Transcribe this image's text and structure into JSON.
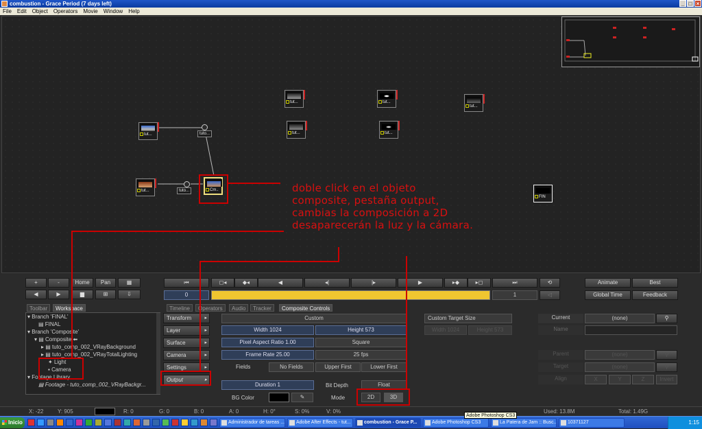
{
  "window": {
    "title": "combustion - Grace Period (7 days left)"
  },
  "menu": [
    "File",
    "Edit",
    "Object",
    "Operators",
    "Movie",
    "Window",
    "Help"
  ],
  "nodes": {
    "short": "tut...",
    "composite": "Cm..",
    "connector": "tuto...",
    "final": "FIN"
  },
  "annotation": [
    "doble click en el objeto",
    "composite, pestaña output,",
    "cambias la composición a 2D",
    "desaparecerán la luz y la cámara."
  ],
  "controls": {
    "plus": "+",
    "minus": "-",
    "home": "Home",
    "pan": "Pan",
    "frame_current": "0",
    "frame_end": "1",
    "animate": "Animate",
    "best": "Best",
    "global_time": "Global Time",
    "feedback": "Feedback"
  },
  "tabs_left": [
    "Toolbar",
    "Workspace"
  ],
  "tabs_right": [
    "Timeline",
    "Operators",
    "Audio",
    "Tracker",
    "Composite Controls"
  ],
  "tree": [
    "Branch 'FINAL'",
    "FINAL",
    "Branch 'Composite'",
    "Composite",
    "tuto_comp_002_VRayBackground",
    "tuto_comp_002_VRayTotalLighting",
    "Light",
    "Camera",
    "Footage Library",
    "Footage - tuto_comp_002_VRayBackgr..."
  ],
  "side_menu": [
    "Transform",
    "Layer",
    "Surface",
    "Camera",
    "Settings",
    "Output"
  ],
  "output": {
    "preset": "Custom",
    "width": "Width 1024",
    "height": "Height 573",
    "aspect": "Pixel Aspect Ratio 1.00",
    "square": "Square",
    "frame_rate": "Frame Rate 25.00",
    "fps": "25 fps",
    "fields_label": "Fields",
    "no_fields": "No Fields",
    "upper_first": "Upper First",
    "lower_first": "Lower First",
    "duration": "Duration 1",
    "bit_depth": "Bit Depth",
    "float": "Float",
    "bg_color": "BG Color",
    "mode": "Mode",
    "mode_2d": "2D",
    "mode_3d": "3D",
    "custom_target": "Custom Target Size",
    "target_w": "Width 1024",
    "target_h": "Height 573"
  },
  "object": {
    "current": "Current",
    "none": "(none)",
    "name": "Name",
    "parent": "Parent",
    "target": "Target",
    "align": "Align",
    "x": "X",
    "y": "Y",
    "z": "Z",
    "invert": "Invert"
  },
  "status": {
    "x": "X:   -22",
    "y": "Y:  905",
    "r": "R: 0",
    "g": "G: 0",
    "b": "B: 0",
    "a": "A: 0",
    "h": "H: 0°",
    "s": "S: 0%",
    "v": "V: 0%",
    "used": "Used: 13.8M",
    "total": "Total: 1.49G"
  },
  "taskbar": {
    "start": "Inicio",
    "items": [
      "Administrador de tareas ...",
      "Adobe After Effects - tut...",
      "combustion - Grace P...",
      "Adobe Photoshop CS3",
      "La Patera de Jam :: Busc...",
      "10371127"
    ],
    "tooltip": "Adobe Photoshop CS3",
    "clock": "1:15"
  }
}
